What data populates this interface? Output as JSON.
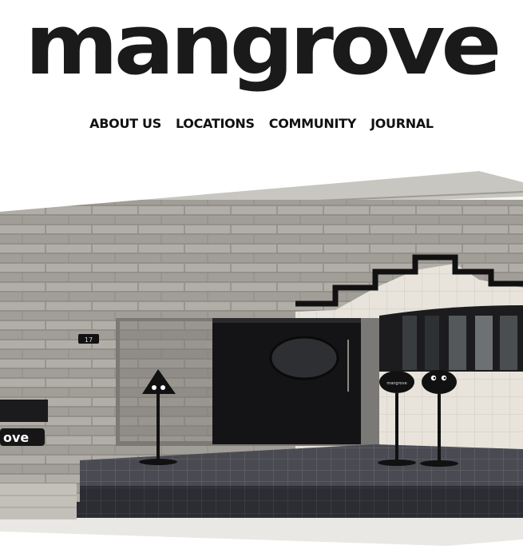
{
  "brand": {
    "logo_text": "mangrove"
  },
  "nav": {
    "items": [
      {
        "label": "ABOUT US"
      },
      {
        "label": "LOCATIONS"
      },
      {
        "label": "COMMUNITY"
      },
      {
        "label": "JOURNAL"
      }
    ]
  },
  "hero": {
    "signage_text": "ove",
    "door_number": "17",
    "stand_sign_text": "mangrove"
  }
}
